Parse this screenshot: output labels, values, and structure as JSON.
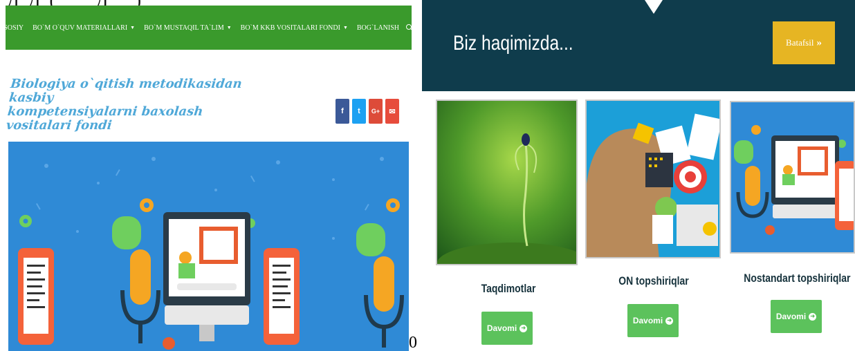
{
  "caption": "Д  Д  (         Д      )",
  "nav": {
    "items": [
      {
        "label": "ASOSIY",
        "dropdown": false
      },
      {
        "label": "BO`M O`QUV MATERIALLARI",
        "dropdown": true
      },
      {
        "label": "BO`M MUSTAQIL TA`LIM",
        "dropdown": true
      },
      {
        "label": "BO`M KKB VOSITALARI FONDI",
        "dropdown": true
      },
      {
        "label": "BOG`LANISH",
        "dropdown": false
      }
    ],
    "color": "#3a9a2c"
  },
  "logo": {
    "line1": "Biologiya o`qitish metodikasidan kasbiy",
    "line2": "kompetensiyalarni baxolash vositalari fondi"
  },
  "social": {
    "facebook": "f",
    "twitter": "t",
    "googleplus": "G+",
    "email": "✉"
  },
  "stray_char": "0",
  "about": {
    "title": "Biz haqimizda...",
    "button": "Batafsil",
    "button_arrow": "»",
    "banner_color": "#0f3c4c",
    "button_color": "#e6b523"
  },
  "cards": [
    {
      "title": "Taqdimotlar",
      "button": "Davomi"
    },
    {
      "title": "ON topshiriqlar",
      "button": "Davomi"
    },
    {
      "title": "Nostandart topshiriqlar",
      "button": "Davomi"
    }
  ],
  "icons": {
    "search": "search-icon",
    "chevron": "chevron-down-icon",
    "arrow": "arrow-circle-right-icon"
  }
}
